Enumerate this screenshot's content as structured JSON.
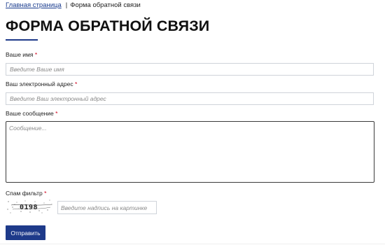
{
  "breadcrumb": {
    "home_label": "Главная страница",
    "separator": "|",
    "current_label": "Форма обратной связи"
  },
  "page": {
    "title": "ФОРМА ОБРАТНОЙ СВЯЗИ"
  },
  "form": {
    "name": {
      "label": "Ваше имя",
      "required_mark": "*",
      "placeholder": "Введите Ваше имя",
      "value": ""
    },
    "email": {
      "label": "Ваш электронный адрес",
      "required_mark": "*",
      "placeholder": "Введите Ваш электронный адрес",
      "value": ""
    },
    "message": {
      "label": "Ваше сообщение",
      "required_mark": "*",
      "placeholder": "Сообщение...",
      "value": ""
    },
    "captcha": {
      "label": "Спам фильтр",
      "required_mark": "*",
      "image_text": "0198",
      "placeholder": "Введите надпись на картинке",
      "value": ""
    },
    "submit_label": "Отправить"
  },
  "colors": {
    "accent": "#1e3a8a",
    "link": "#1a3c8e",
    "required": "#d0021b"
  }
}
